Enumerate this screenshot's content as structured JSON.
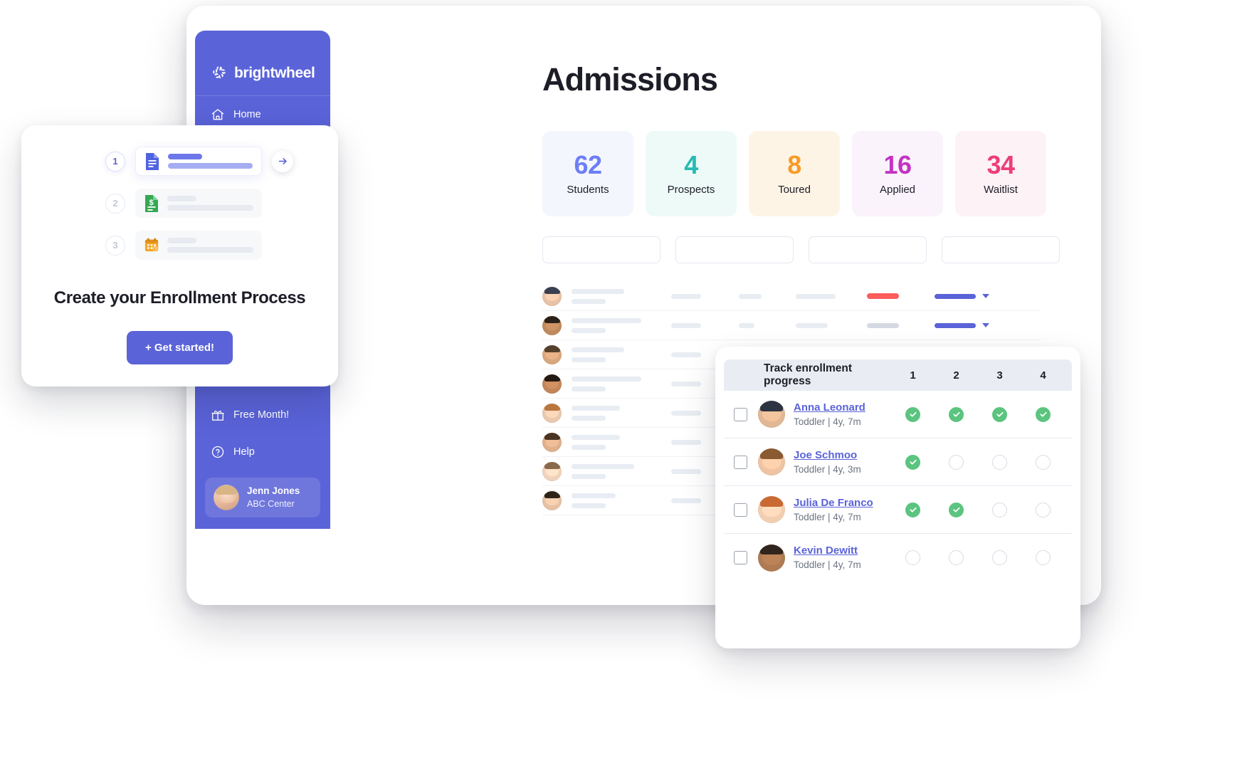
{
  "brand": {
    "name": "brightwheel",
    "primary": "#5a63d8",
    "logo_icon": "brightwheel-pinwheel-icon"
  },
  "sidebar": {
    "nav": [
      {
        "label": "Home",
        "icon": "home-icon"
      }
    ],
    "bottom": [
      {
        "label": "Free Month!",
        "icon": "gift-icon"
      },
      {
        "label": "Help",
        "icon": "question-circle-icon"
      }
    ],
    "profile": {
      "name": "Jenn Jones",
      "org": "ABC Center",
      "avatar": "user-avatar"
    }
  },
  "main": {
    "title": "Admissions",
    "stats": [
      {
        "value": "62",
        "label": "Students",
        "color": "#6d7ef5",
        "bg": "#f4f6fe"
      },
      {
        "value": "4",
        "label": "Prospects",
        "color": "#27bbb4",
        "bg": "#eefaf7"
      },
      {
        "value": "8",
        "label": "Toured",
        "color": "#f99b26",
        "bg": "#fef4e6"
      },
      {
        "value": "16",
        "label": "Applied",
        "color": "#c333c3",
        "bg": "#fbf3fb"
      },
      {
        "value": "34",
        "label": "Waitlist",
        "color": "#ef3d79",
        "bg": "#fdf2f5"
      }
    ],
    "filters": [
      {
        "placeholder": ""
      },
      {
        "placeholder": ""
      },
      {
        "placeholder": ""
      },
      {
        "placeholder": ""
      }
    ],
    "table_rows": [
      {
        "name_w": 74,
        "sub_w": 48,
        "c2": 42,
        "c3": 32,
        "c4": 56,
        "status": "red",
        "status_w": 45,
        "action": true
      },
      {
        "name_w": 98,
        "sub_w": 48,
        "c2": 42,
        "c3": 22,
        "c4": 45,
        "status": "dk",
        "status_w": 45,
        "action": true
      },
      {
        "name_w": 74,
        "sub_w": 48,
        "c2": 42,
        "c3": 32,
        "c4": 56,
        "status": "red",
        "status_w": 45,
        "action": true
      },
      {
        "name_w": 98,
        "sub_w": 48,
        "c2": 42,
        "c3": 22,
        "c4": 45,
        "status": "dk",
        "status_w": 32,
        "action": false
      },
      {
        "name_w": 68,
        "sub_w": 48,
        "c2": 42,
        "c3": 22,
        "c4": 45,
        "status": "dk",
        "status_w": 32,
        "action": false
      },
      {
        "name_w": 68,
        "sub_w": 48,
        "c2": 42,
        "c3": 22,
        "c4": 45,
        "status": "dk",
        "status_w": 32,
        "action": false
      },
      {
        "name_w": 88,
        "sub_w": 48,
        "c2": 42,
        "c3": 22,
        "c4": 45,
        "status": "dk",
        "status_w": 32,
        "action": false
      },
      {
        "name_w": 62,
        "sub_w": 48,
        "c2": 42,
        "c3": 22,
        "c4": 45,
        "status": "dk",
        "status_w": 32,
        "action": false
      }
    ]
  },
  "enrollment_card": {
    "title": "Create your Enrollment Process",
    "cta_label": "+ Get started!",
    "steps": [
      {
        "number": "1",
        "icon": "document-icon",
        "active": true
      },
      {
        "number": "2",
        "icon": "invoice-dollar-icon",
        "active": false
      },
      {
        "number": "3",
        "icon": "calendar-icon",
        "active": false
      }
    ],
    "next_icon": "arrow-right-icon"
  },
  "progress_card": {
    "header_title": "Track enrollment progress",
    "columns": [
      "1",
      "2",
      "3",
      "4"
    ],
    "rows": [
      {
        "name": "Anna Leonard",
        "details": "Toddler  |  4y, 7m",
        "steps": [
          true,
          true,
          true,
          true
        ],
        "checked": false,
        "skin": "#e2b894",
        "hair": "#2e3344"
      },
      {
        "name": "Joe Schmoo",
        "details": "Toddler  |  4y, 3m",
        "steps": [
          true,
          false,
          false,
          false
        ],
        "checked": false,
        "skin": "#eec4a3",
        "hair": "#8a5a33"
      },
      {
        "name": "Julia De Franco",
        "details": "Toddler  |  4y, 7m",
        "steps": [
          true,
          true,
          false,
          false
        ],
        "checked": false,
        "skin": "#f3cfb2",
        "hair": "#c96a33"
      },
      {
        "name": "Kevin Dewitt",
        "details": "Toddler  |  4y, 7m",
        "steps": [
          false,
          false,
          false,
          false
        ],
        "checked": false,
        "skin": "#b07a52",
        "hair": "#31241c"
      }
    ],
    "done_color": "#5bc47f",
    "pending_color": "#d7dbe2"
  }
}
